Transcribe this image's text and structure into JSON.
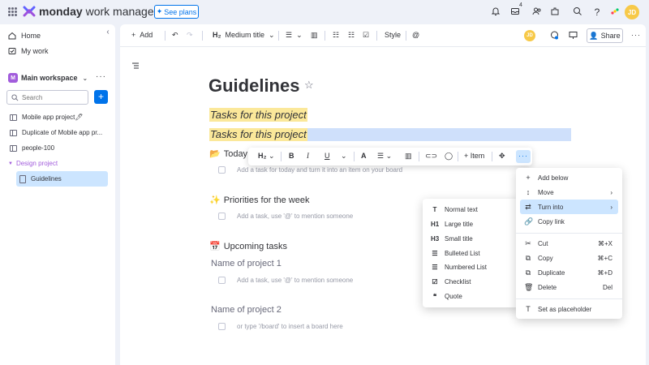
{
  "app": {
    "brand_bold": "monday",
    "brand_rest": " work management",
    "see_plans": "See plans",
    "inbox_badge": "4",
    "user_initials": "JD"
  },
  "sidebar": {
    "home": "Home",
    "my_work": "My work",
    "workspace_badge": "M",
    "workspace_name": "Main workspace",
    "search_placeholder": "Search",
    "boards": [
      "Mobile app project🖊",
      "Duplicate of Mobile app pr...",
      "people-100"
    ],
    "folder": "Design project",
    "active_doc": "Guidelines"
  },
  "toolbar": {
    "add": "Add",
    "heading_style": "Medium title",
    "style": "Style",
    "share": "Share",
    "user_initials": "JD"
  },
  "doc": {
    "title": "Guidelines",
    "highlight1": "Tasks for this project",
    "highlight2": "Tasks for this project",
    "sections": [
      {
        "emoji": "📂",
        "title": "Today",
        "task": "Add a task for today and turn it into an item on your board"
      },
      {
        "emoji": "✨",
        "title": "Priorities for the week",
        "task": "Add a task, use '@' to mention someone"
      },
      {
        "emoji": "📅",
        "title": "Upcoming tasks",
        "task": ""
      }
    ],
    "projects": [
      {
        "title": "Name of project 1",
        "task": "Add a task, use '@' to mention someone"
      },
      {
        "title": "Name of project 2",
        "task": "or type '/board' to insert a board here"
      }
    ]
  },
  "format_bar": {
    "heading": "H₂",
    "item": "Item"
  },
  "turn_into_menu": [
    {
      "icon": "T",
      "label": "Normal text"
    },
    {
      "icon": "H1",
      "label": "Large title"
    },
    {
      "icon": "H3",
      "label": "Small title"
    },
    {
      "icon": "☰",
      "label": "Bulleted List"
    },
    {
      "icon": "☰",
      "label": "Numbered List"
    },
    {
      "icon": "☑",
      "label": "Checklist"
    },
    {
      "icon": "❝",
      "label": "Quote"
    }
  ],
  "context_menu": [
    {
      "icon": "+",
      "label": "Add below",
      "shortcut": ""
    },
    {
      "icon": "↕",
      "label": "Move",
      "shortcut": "›"
    },
    {
      "icon": "⇄",
      "label": "Turn into",
      "shortcut": "›"
    },
    {
      "icon": "🔗",
      "label": "Copy link",
      "shortcut": ""
    },
    {
      "icon": "✂",
      "label": "Cut",
      "shortcut": "⌘+X"
    },
    {
      "icon": "⧉",
      "label": "Copy",
      "shortcut": "⌘+C"
    },
    {
      "icon": "⧉",
      "label": "Duplicate",
      "shortcut": "⌘+D"
    },
    {
      "icon": "🗑",
      "label": "Delete",
      "shortcut": "Del"
    },
    {
      "icon": "T",
      "label": "Set as placeholder",
      "shortcut": ""
    }
  ],
  "colors": {
    "accent": "#0073ea",
    "highlight": "#fbe89a",
    "selection": "#cfe0fb",
    "workspace": "#a25ddc"
  }
}
